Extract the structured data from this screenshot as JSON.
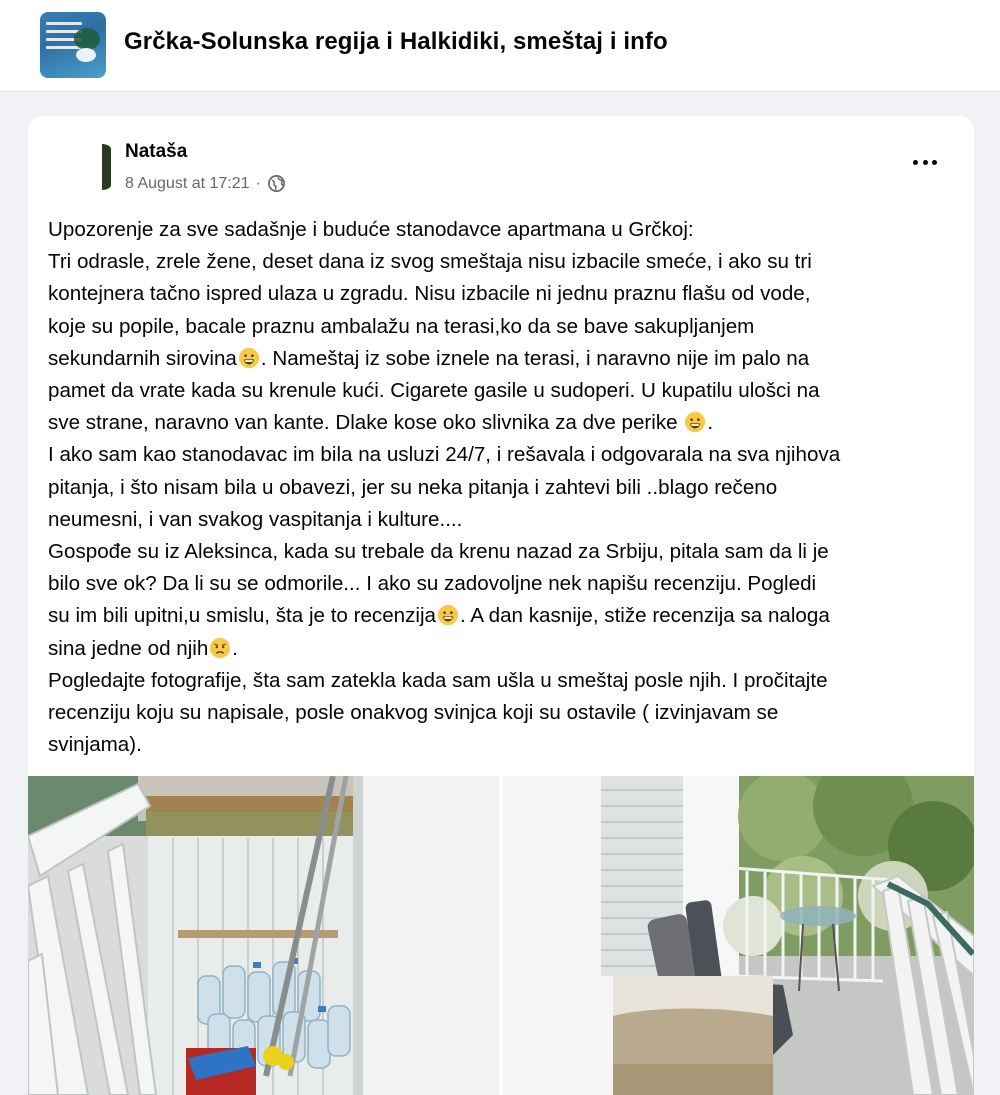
{
  "group": {
    "title": "Grčka-Solunska regija i Halkidiki, smeštaj i info"
  },
  "post": {
    "author": "Nataša",
    "date": "8 August at 17:21",
    "separator": "·",
    "audience_icon": "globe-icon",
    "more_icon": "more-options-icon",
    "lines": [
      "Upozorenje za sve sadašnje i buduće stanodavce apartmana u Grčkoj:",
      "Tri odrasle, zrele žene, deset dana iz svog smeštaja nisu izbacile smeće, i ako su tri",
      "kontejnera tačno ispred ulaza u zgradu. Nisu izbacile ni jednu praznu flašu od vode,",
      "koje su popile, bacale praznu ambalažu na terasi,ko da se bave sakupljanjem",
      "sekundarnih sirovina",
      ". Nameštaj iz sobe iznele na terasi, i naravno nije im palo na",
      "pamet da vrate kada su krenule kući. Cigarete gasile u sudoperi. U kupatilu ulošci na",
      "sve strane, naravno van kante.  Dlake kose oko slivnika za dve perike",
      ".",
      "I ako sam kao stanodavac im bila na usluzi 24/7, i rešavala i odgovarala na sva njihova",
      "pitanja, i što nisam bila u obavezi, jer su neka pitanja i zahtevi bili ..blago rečeno",
      "neumesni, i van svakog vaspitanja i kulture....",
      "Gospođe su iz Aleksinca, kada su trebale da krenu nazad za Srbiju, pitala sam da li je",
      "bilo sve ok? Da li su se odmorile... I ako su zadovoljne nek napišu recenziju. Pogledi",
      "su im bili upitni,u smislu, šta je to recenzija",
      ". A dan kasnije, stiže recenzija sa naloga",
      "sina jedne od njih",
      ".",
      "Pogledajte fotografije, šta sam zatekla kada sam ušla u smeštaj posle njih. I pročitajte",
      "recenziju koju su napisale, posle onakvog svinjca koji su ostavile ( izvinjavam se",
      "svinjama)."
    ],
    "emoji": [
      "grinning-face-emoji",
      "grinning-face-emoji",
      "grinning-face-emoji",
      "worried-face-emoji"
    ],
    "photos": [
      "balcony-with-empty-bottles-photo",
      "balcony-with-furniture-photo"
    ]
  }
}
